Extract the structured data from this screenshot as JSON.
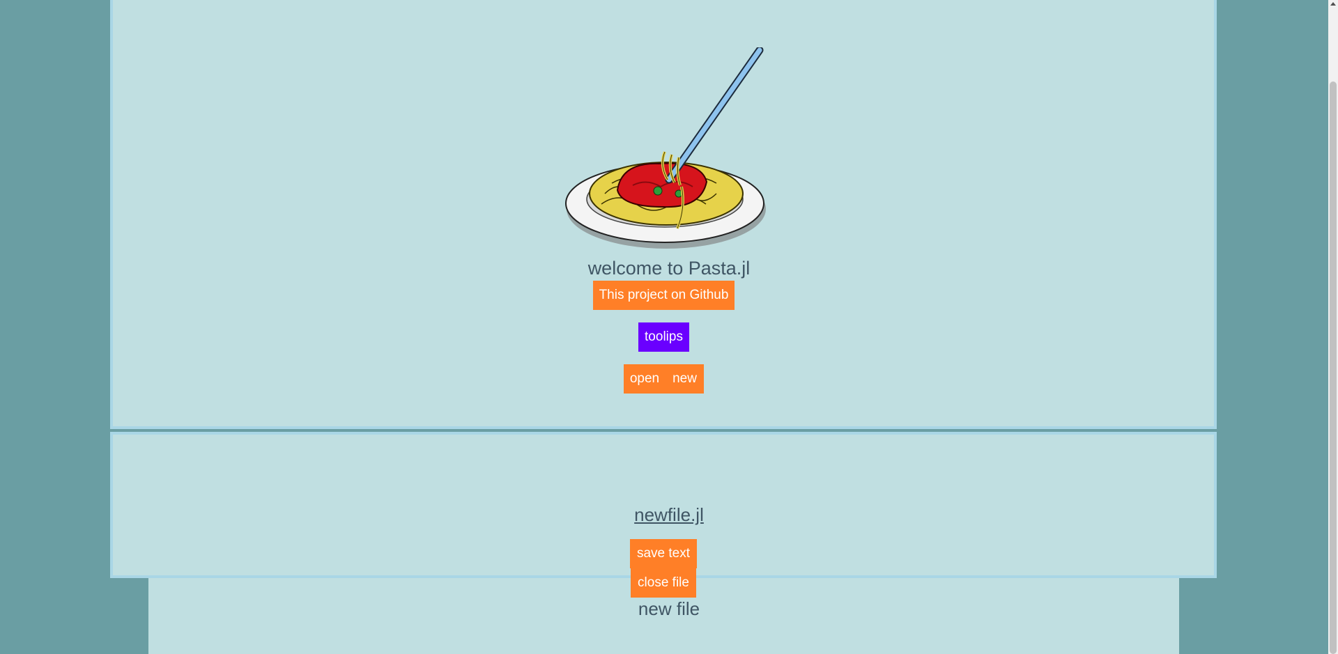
{
  "header": {
    "title": "welcome to Pasta.jl",
    "github_label": "This project on Github",
    "toolips_label": "toolips",
    "open_label": "open",
    "new_label": "new"
  },
  "editor": {
    "filename": "newfile.jl",
    "save_label": "save text",
    "close_label": "close file",
    "new_file_label": "new file"
  },
  "colors": {
    "background": "#6a9ea3",
    "panel": "#c0dfe1",
    "panel_border": "#a9d6e6",
    "orange_button": "#ff7f27",
    "purple_button": "#6a00ff",
    "text": "#3f5564"
  },
  "icons": {
    "logo": "spaghetti-plate-icon"
  }
}
